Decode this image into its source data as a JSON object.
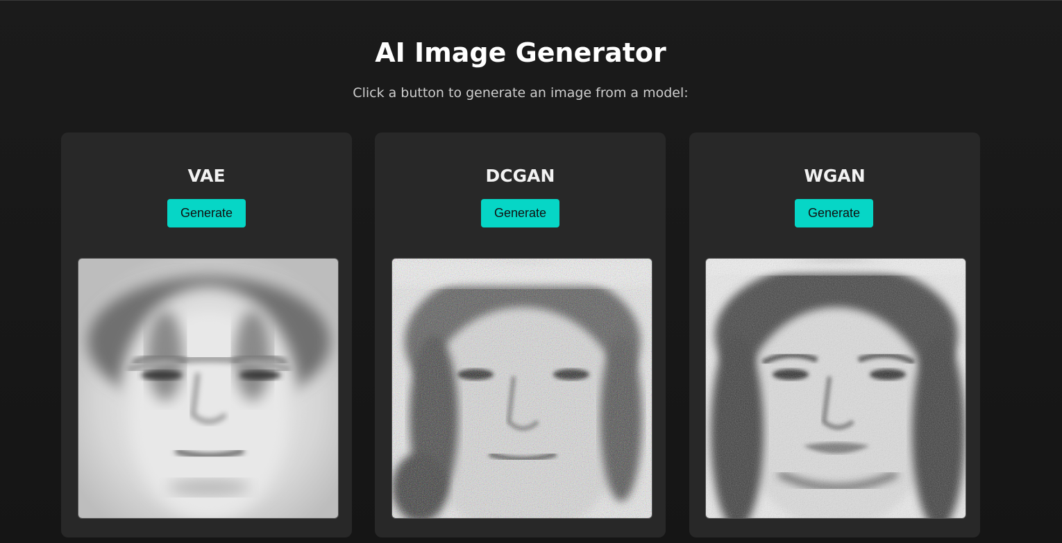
{
  "header": {
    "title": "AI Image Generator",
    "subtitle": "Click a button to generate an image from a model:"
  },
  "models": [
    {
      "name": "VAE",
      "button_label": "Generate",
      "image_style": "blurry-grayscale-face"
    },
    {
      "name": "DCGAN",
      "button_label": "Generate",
      "image_style": "noisy-color-speckled-face"
    },
    {
      "name": "WGAN",
      "button_label": "Generate",
      "image_style": "grainy-grayscale-face"
    }
  ],
  "colors": {
    "background": "#181818",
    "card": "#282828",
    "accent": "#06d6c6"
  }
}
